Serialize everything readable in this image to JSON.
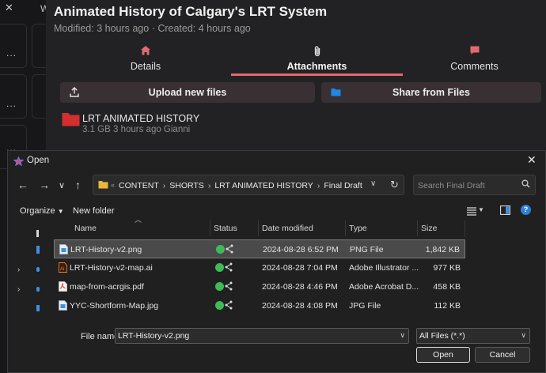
{
  "app": {
    "title": "Animated History of Calgary's LRT System",
    "subtitle": "Modified: 3 hours ago · Created: 4 hours ago",
    "rail_initial": "W",
    "rail_dots": "..."
  },
  "tabs": [
    {
      "label": "Details",
      "icon": "home-icon"
    },
    {
      "label": "Attachments",
      "icon": "paperclip-icon",
      "active": true
    },
    {
      "label": "Comments",
      "icon": "comment-icon"
    }
  ],
  "actions": {
    "upload_label": "Upload new files",
    "share_label": "Share from Files"
  },
  "folder": {
    "name": "LRT ANIMATED HISTORY",
    "meta": "3.1 GB 3 hours ago Gianni",
    "color": "#d32f2f"
  },
  "dialog": {
    "title": "Open",
    "breadcrumbs": [
      "CONTENT",
      "SHORTS",
      "LRT ANIMATED HISTORY",
      "Final Draft"
    ],
    "search_placeholder": "Search Final Draft",
    "organize_label": "Organize",
    "new_folder_label": "New folder",
    "columns": [
      "Name",
      "Status",
      "Date modified",
      "Type",
      "Size"
    ],
    "files": [
      {
        "name": "LRT-History-v2.png",
        "date": "2024-08-28 6:52 PM",
        "type": "PNG File",
        "size": "1,842 KB",
        "icon": "image-file-icon",
        "selected": true
      },
      {
        "name": "LRT-History-v2-map.ai",
        "date": "2024-08-28 7:04 PM",
        "type": "Adobe Illustrator ...",
        "size": "977 KB",
        "icon": "illustrator-file-icon"
      },
      {
        "name": "map-from-acrgis.pdf",
        "date": "2024-08-28 4:46 PM",
        "type": "Adobe Acrobat D...",
        "size": "458 KB",
        "icon": "pdf-file-icon"
      },
      {
        "name": "YYC-Shortform-Map.jpg",
        "date": "2024-08-28 4:08 PM",
        "type": "JPG File",
        "size": "112 KB",
        "icon": "image-file-icon"
      }
    ],
    "filename_label": "File name:",
    "filename_value": "LRT-History-v2.png",
    "filetype_value": "All Files (*.*)",
    "open_label": "Open",
    "cancel_label": "Cancel"
  },
  "colors": {
    "accent": "#e26a6f",
    "status_ok": "#3fba57",
    "share_blue": "#1e88e5"
  }
}
